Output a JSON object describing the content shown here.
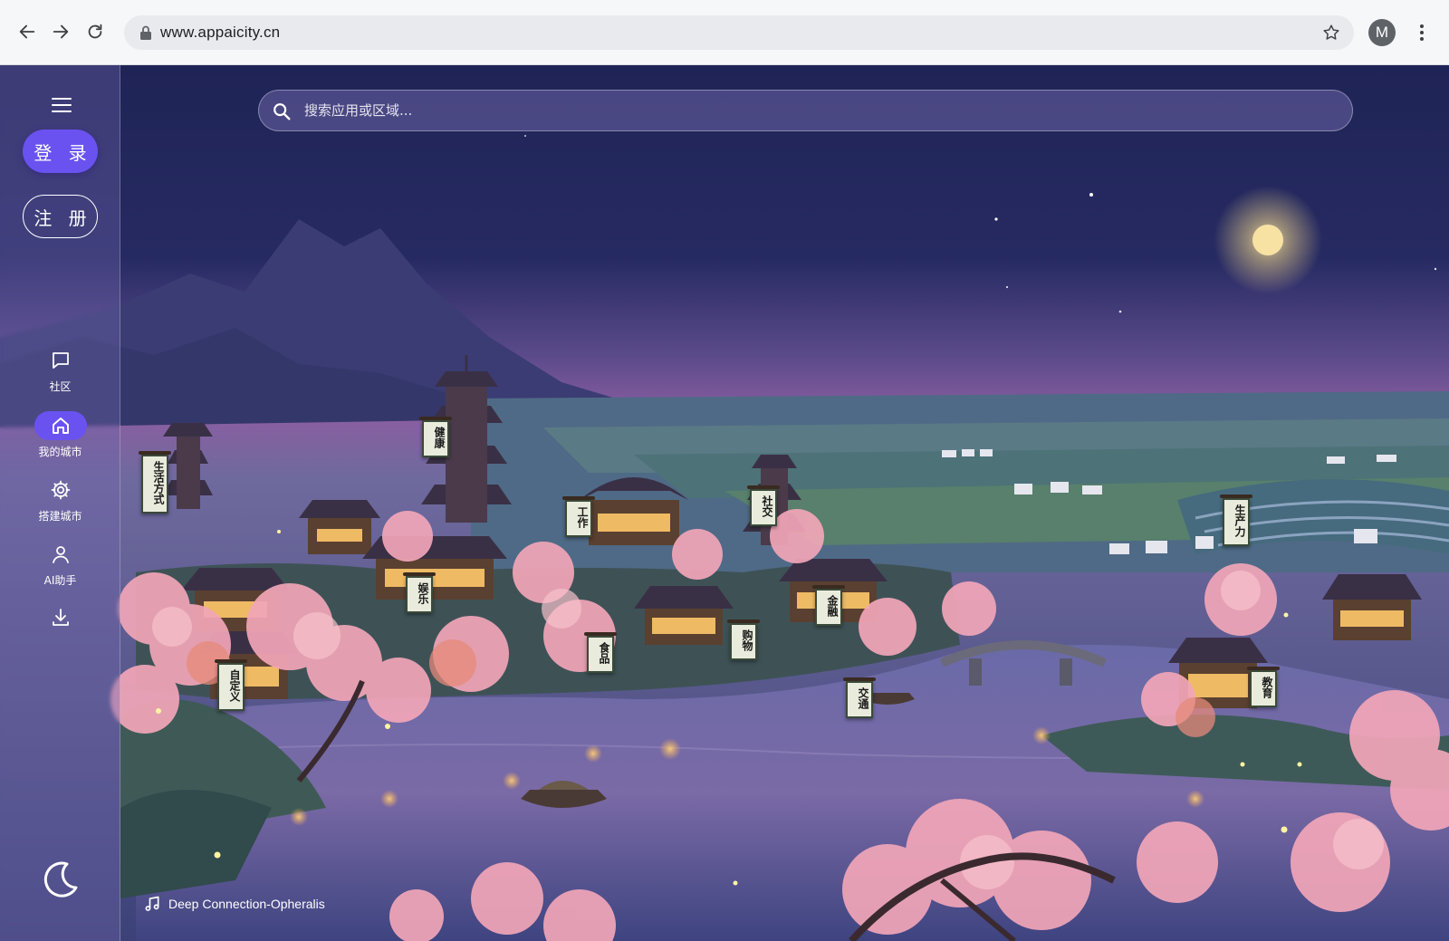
{
  "browser": {
    "url": "www.appaicity.cn",
    "profile_initial": "M"
  },
  "sidebar": {
    "login_label": "登 录",
    "register_label": "注 册",
    "nav": [
      {
        "label": "社区",
        "icon": "chat-icon"
      },
      {
        "label": "我的城市",
        "icon": "home-icon",
        "active": true
      },
      {
        "label": "搭建城市",
        "icon": "gear-icon"
      },
      {
        "label": "AI助手",
        "icon": "user-icon"
      }
    ]
  },
  "search": {
    "placeholder": "搜索应用或区域..."
  },
  "music": {
    "track": "Deep Connection-Opheralis"
  },
  "districts": [
    {
      "label": "生活方式"
    },
    {
      "label": "健康"
    },
    {
      "label": "工作"
    },
    {
      "label": "社交"
    },
    {
      "label": "生产力"
    },
    {
      "label": "娱乐"
    },
    {
      "label": "金融"
    },
    {
      "label": "食品"
    },
    {
      "label": "购物"
    },
    {
      "label": "自定义"
    },
    {
      "label": "交通"
    },
    {
      "label": "教育"
    }
  ],
  "colors": {
    "accent": "#6a52f0",
    "sky_top": "#1f2456",
    "sky_horizon": "#8a5ea0",
    "blossom": "#f2a6b8"
  }
}
